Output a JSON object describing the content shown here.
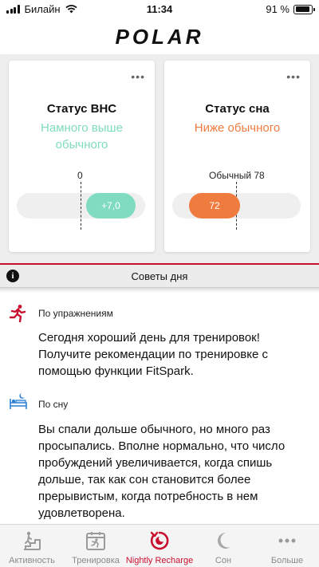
{
  "status_bar": {
    "carrier": "Билайн",
    "time": "11:34",
    "battery_percent": "91 %",
    "battery_level": 0.91
  },
  "header": {
    "logo": "POLAR"
  },
  "cards": {
    "hrv": {
      "title": "Статус ВНС",
      "status": "Намного выше обычного",
      "status_color": "#7fdcc0",
      "marker_label": "0",
      "value": "+7,0"
    },
    "sleep": {
      "title": "Статус сна",
      "status": "Ниже обычного",
      "status_color": "#f07b3f",
      "marker_label": "Обычный 78",
      "value": "72"
    }
  },
  "tips": {
    "header": "Советы дня",
    "items": [
      {
        "category": "По упражнениям",
        "icon": "running-icon",
        "text": "Сегодня хороший день для тренировок! Получите рекомендации по тренировке с помощью функции FitSpark."
      },
      {
        "category": "По сну",
        "icon": "bed-icon",
        "text": "Вы спали дольше обычного, но много раз просыпались. Вполне нормально, что число пробуждений увеличивается, когда спишь дольше, так как сон становится более прерывистым, когда потребность в нем удовлетворена."
      }
    ]
  },
  "tabbar": {
    "items": [
      {
        "label": "Активность",
        "icon": "activity-icon"
      },
      {
        "label": "Тренировка",
        "icon": "training-icon"
      },
      {
        "label": "Nightly Recharge",
        "icon": "recharge-icon"
      },
      {
        "label": "Сон",
        "icon": "moon-icon"
      },
      {
        "label": "Больше",
        "icon": "more-icon"
      }
    ],
    "active": "Nightly Recharge",
    "accent": "#c8102e"
  }
}
